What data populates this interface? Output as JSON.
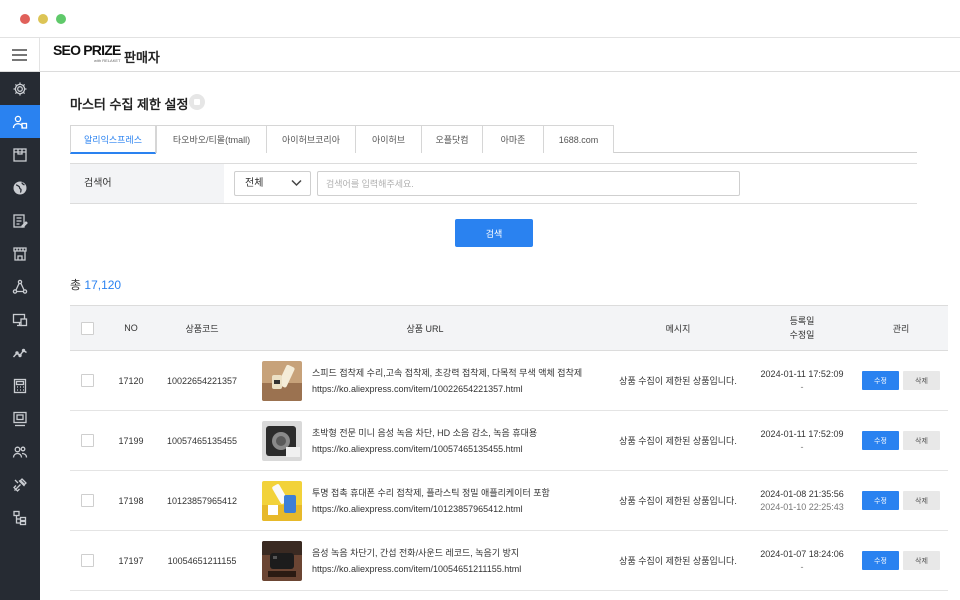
{
  "header": {
    "logo": "SEO PRIZE",
    "logo_sub": "with RELAKET",
    "role": "판매자"
  },
  "sidebar": {
    "items": [
      {
        "icon": "settings-icon",
        "active": false
      },
      {
        "icon": "user-icon",
        "active": true
      },
      {
        "icon": "box-icon",
        "active": false
      },
      {
        "icon": "globe-icon",
        "active": false
      },
      {
        "icon": "document-edit-icon",
        "active": false
      },
      {
        "icon": "store-icon",
        "active": false
      },
      {
        "icon": "network-icon",
        "active": false
      },
      {
        "icon": "screen-icon",
        "active": false
      },
      {
        "icon": "trend-icon",
        "active": false
      },
      {
        "icon": "calculator-icon",
        "active": false
      },
      {
        "icon": "monitor-icon",
        "active": false
      },
      {
        "icon": "users-icon",
        "active": false
      },
      {
        "icon": "tools-icon",
        "active": false
      },
      {
        "icon": "hierarchy-icon",
        "active": false
      }
    ]
  },
  "page": {
    "title": "마스터 수집 제한 설정"
  },
  "tabs": [
    {
      "label": "알리익스프레스",
      "active": true
    },
    {
      "label": "타오바오/티몰(tmall)",
      "active": false
    },
    {
      "label": "아이허브코리아",
      "active": false
    },
    {
      "label": "아이허브",
      "active": false
    },
    {
      "label": "오플닷컴",
      "active": false
    },
    {
      "label": "아마존",
      "active": false
    },
    {
      "label": "1688.com",
      "active": false
    }
  ],
  "search": {
    "label": "검색어",
    "select_value": "전체",
    "input_value": "",
    "placeholder": "검색어를 입력해주세요.",
    "button": "검색"
  },
  "total": {
    "prefix": "총",
    "count": "17,120"
  },
  "table": {
    "headers": {
      "no": "NO",
      "code": "상품코드",
      "url": "상품 URL",
      "message": "메시지",
      "date_registered": "등록일",
      "date_modified": "수정일",
      "manage": "관리"
    },
    "rows": [
      {
        "no": "17120",
        "code": "10022654221357",
        "name": "스피드 접착제 수리,고속 접착제, 초강력 접착제, 다목적 무색 액체 접착제",
        "url": "https://ko.aliexpress.com/item/10022654221357.html",
        "message": "상품 수집이 제한된 상품입니다.",
        "registered": "2024-01-11 17:52:09",
        "modified": "-",
        "edit": "수정",
        "delete": "삭제",
        "thumb_colors": [
          "#b58a63",
          "#f1e4c9"
        ]
      },
      {
        "no": "17199",
        "code": "10057465135455",
        "name": "초박형 전문 미니 음성 녹음 차단, HD 소음 감소, 녹음 휴대용",
        "url": "https://ko.aliexpress.com/item/10057465135455.html",
        "message": "상품 수집이 제한된 상품입니다.",
        "registered": "2024-01-11 17:52:09",
        "modified": "-",
        "edit": "수정",
        "delete": "삭제",
        "thumb_colors": [
          "#9a9a9a",
          "#2c2c2c"
        ]
      },
      {
        "no": "17198",
        "code": "10123857965412",
        "name": "투명 접촉 휴대폰 수리 접착제, 플라스틱 정밀 애플리케이터 포함",
        "url": "https://ko.aliexpress.com/item/10123857965412.html",
        "message": "상품 수집이 제한된 상품입니다.",
        "registered": "2024-01-08 21:35:56",
        "modified": "2024-01-10 22:25:43",
        "edit": "수정",
        "delete": "삭제",
        "thumb_colors": [
          "#f2d23a",
          "#3d7fd6"
        ]
      },
      {
        "no": "17197",
        "code": "10054651211155",
        "name": "음성 녹음 차단기, 간섭 전화/사운드 레코드, 녹음기 방지",
        "url": "https://ko.aliexpress.com/item/10054651211155.html",
        "message": "상품 수집이 제한된 상품입니다.",
        "registered": "2024-01-07 18:24:06",
        "modified": "-",
        "edit": "수정",
        "delete": "삭제",
        "thumb_colors": [
          "#5a3a2a",
          "#1c1c1c"
        ]
      }
    ]
  },
  "colors": {
    "accent": "#2a82f0",
    "sidebar": "#262b33"
  }
}
